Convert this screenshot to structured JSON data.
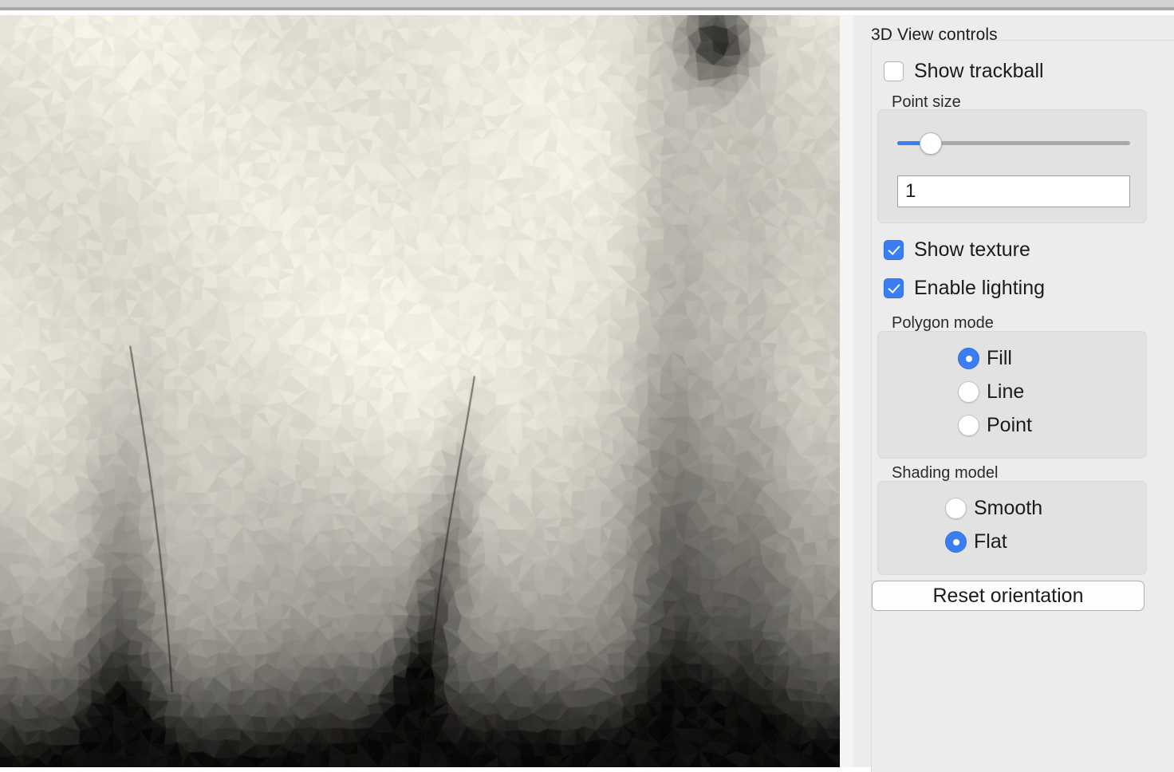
{
  "window": {
    "chrome_visible": true
  },
  "viewport": {
    "name": "3d-mesh-viewport",
    "render_mode": "flat-shaded-triangle-mesh",
    "background_color": "#f2f2f2",
    "palette": [
      "#ebe9e4",
      "#dedbd4",
      "#c9c5bc",
      "#a9a49a",
      "#8a867c",
      "#6d6a62",
      "#4a4841",
      "#2a2824",
      "#141310"
    ]
  },
  "panel": {
    "title": "3D View controls",
    "show_trackball": {
      "label": "Show trackball",
      "checked": false
    },
    "point_size": {
      "label": "Point size",
      "slider_value": 1,
      "slider_min": 1,
      "slider_max": 10,
      "field_value": "1"
    },
    "show_texture": {
      "label": "Show texture",
      "checked": true
    },
    "enable_lighting": {
      "label": "Enable lighting",
      "checked": true
    },
    "polygon_mode": {
      "label": "Polygon mode",
      "selected": "Fill",
      "options": [
        {
          "label": "Fill",
          "selected": true
        },
        {
          "label": "Line",
          "selected": false
        },
        {
          "label": "Point",
          "selected": false
        }
      ]
    },
    "shading_model": {
      "label": "Shading model",
      "selected": "Flat",
      "options": [
        {
          "label": "Smooth",
          "selected": false
        },
        {
          "label": "Flat",
          "selected": true
        }
      ]
    },
    "reset_button": {
      "label": "Reset orientation"
    }
  },
  "colors": {
    "accent": "#3b7df4",
    "panel_background": "#ececec",
    "group_background": "#e2e2e2",
    "text": "#1b1b1b",
    "chrome_band": "#d2d2d2",
    "chrome_rule": "#a9a9a9"
  }
}
